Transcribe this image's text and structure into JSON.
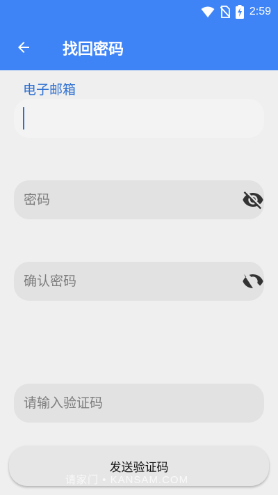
{
  "status_bar": {
    "time": "2:59",
    "icons": [
      "wifi-icon",
      "no-sim-icon",
      "battery-charging-icon"
    ]
  },
  "toolbar": {
    "back_icon": "arrow-back-icon",
    "title": "找回密码"
  },
  "form": {
    "email_label": "电子邮箱",
    "email_value": "",
    "password_placeholder": "密码",
    "confirm_password_placeholder": "确认密码",
    "code_placeholder": "请输入验证码",
    "visibility_icon": "visibility-off-icon"
  },
  "send_button_label": "发送验证码",
  "watermark": "请家门 • KANSAM.COM",
  "colors": {
    "accent": "#3f84f6",
    "label": "#2d6fd1",
    "field_bg": "#e2e2e2",
    "page_bg": "#efefef"
  }
}
